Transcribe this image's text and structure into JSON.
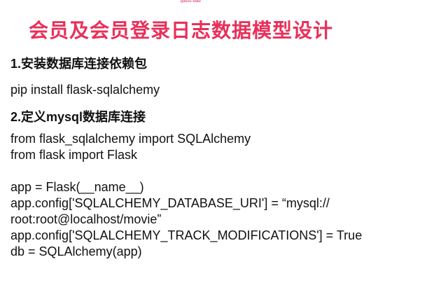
{
  "header_mark": "gasss ioad",
  "title": "会员及会员登录日志数据模型设计",
  "sections": [
    {
      "heading": "1.安装数据库连接依赖包",
      "lines": [
        "pip install flask-sqlalchemy"
      ]
    },
    {
      "heading": "2.定义mysql数据库连接",
      "lines": [
        "from flask_sqlalchemy import SQLAlchemy",
        "from flask import Flask",
        "",
        "app = Flask(__name__)",
        "app.config['SQLALCHEMY_DATABASE_URI'] = “mysql://",
        "root:root@localhost/movie”",
        "app.config['SQLALCHEMY_TRACK_MODIFICATIONS'] = True",
        "db = SQLAlchemy(app)"
      ]
    }
  ],
  "colors": {
    "title": "#e8305a",
    "text": "#111111",
    "background": "#ffffff"
  }
}
